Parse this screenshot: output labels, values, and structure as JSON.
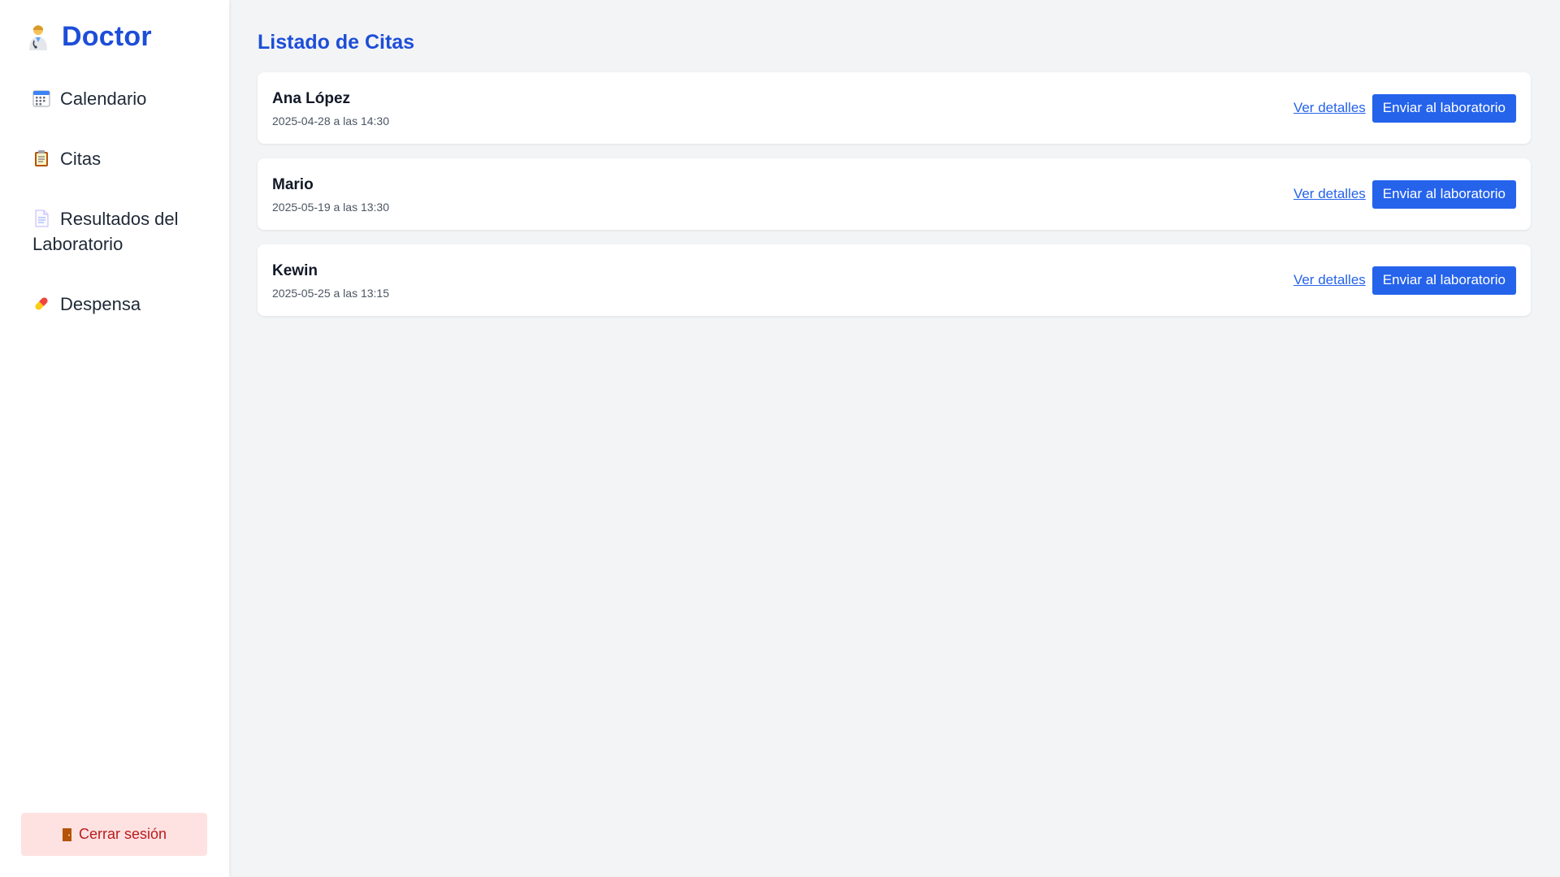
{
  "sidebar": {
    "brand": {
      "title": "Doctor",
      "icon": "doctor-emoji-icon"
    },
    "items": [
      {
        "label": "Calendario",
        "icon": "calendar-icon"
      },
      {
        "label": "Citas",
        "icon": "clipboard-icon"
      },
      {
        "label": "Resultados del Laboratorio",
        "icon": "document-icon"
      },
      {
        "label": "Despensa",
        "icon": "pill-icon"
      }
    ],
    "logout": {
      "label": "Cerrar sesión",
      "icon": "door-icon"
    }
  },
  "main": {
    "title": "Listado de Citas",
    "appointments": [
      {
        "patient": "Ana López",
        "datetime": "2025-04-28 a las 14:30",
        "details_label": "Ver detalles",
        "lab_label": "Enviar al laboratorio"
      },
      {
        "patient": "Mario",
        "datetime": "2025-05-19 a las 13:30",
        "details_label": "Ver detalles",
        "lab_label": "Enviar al laboratorio"
      },
      {
        "patient": "Kewin",
        "datetime": "2025-05-25 a las 13:15",
        "details_label": "Ver detalles",
        "lab_label": "Enviar al laboratorio"
      }
    ]
  },
  "colors": {
    "accent": "#1d4ed8",
    "button": "#2563eb",
    "logout_bg": "#fee2e2",
    "logout_text": "#b91c1c",
    "background": "#f3f4f6"
  }
}
